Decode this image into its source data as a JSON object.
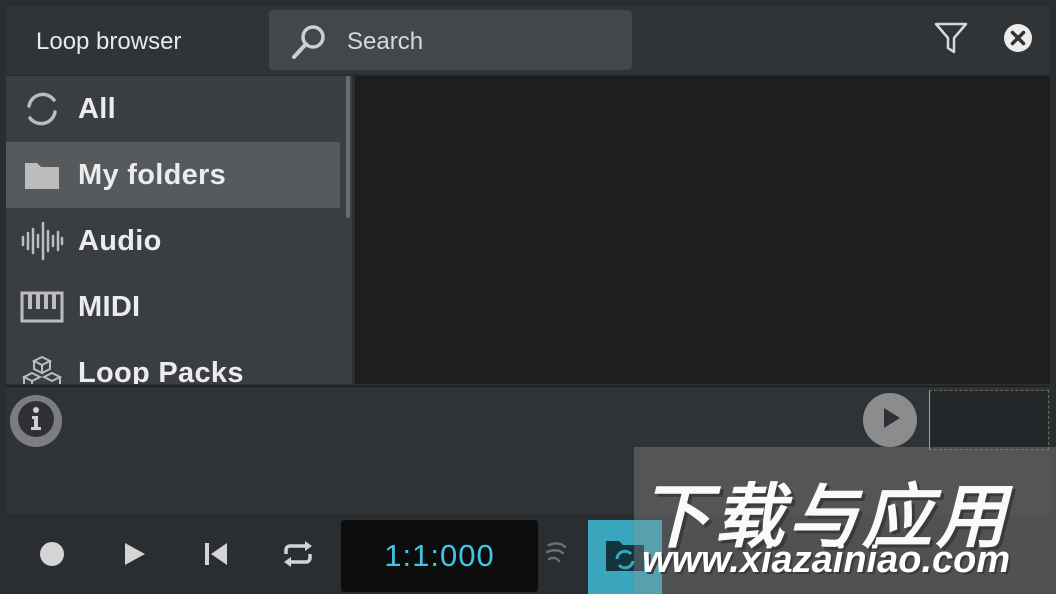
{
  "header": {
    "title": "Loop browser",
    "search_placeholder": "Search",
    "icons": [
      "search-icon",
      "filter-icon",
      "close-icon"
    ]
  },
  "sidebar": {
    "items": [
      {
        "label": "All",
        "icon": "all-cycle-icon",
        "selected": false
      },
      {
        "label": "My folders",
        "icon": "folder-icon",
        "selected": true
      },
      {
        "label": "Audio",
        "icon": "audio-waveform-icon",
        "selected": false
      },
      {
        "label": "MIDI",
        "icon": "midi-keyboard-icon",
        "selected": false
      },
      {
        "label": "Loop Packs",
        "icon": "loop-packs-cubes-icon",
        "selected": false
      }
    ]
  },
  "preview": {
    "icons": [
      "info-icon",
      "play-icon"
    ]
  },
  "transport": {
    "time": "1:1:000",
    "icons": [
      "record-icon",
      "play-icon",
      "skip-to-start-icon",
      "loop-repeat-icon",
      "metronome-icon",
      "loop-browser-icon"
    ],
    "accent": "#3aa6bd",
    "time_color": "#3fc6e6"
  },
  "watermark": {
    "cn": "下载与应用",
    "url": "www.xiazainiao.com"
  },
  "colors": {
    "background": "#2b2e31",
    "selected_item": "#575a5d",
    "selection_line": "#c7a14a"
  }
}
